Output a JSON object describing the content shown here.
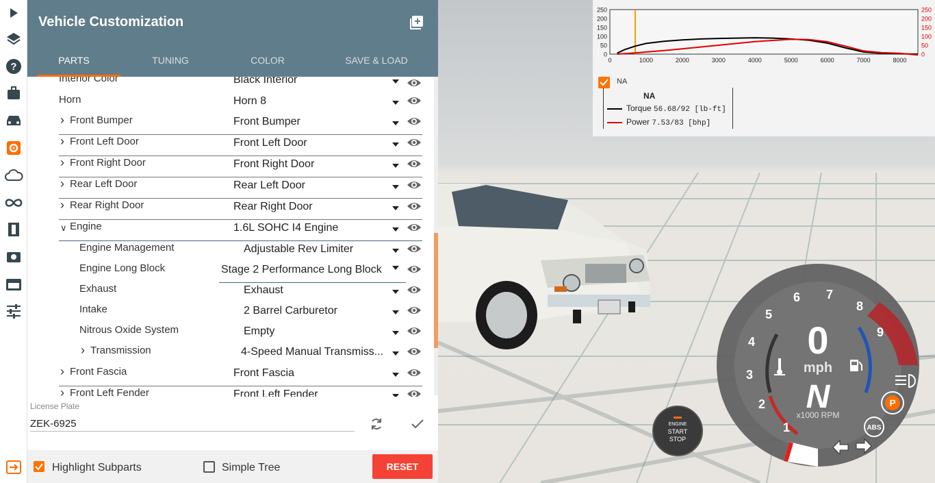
{
  "panel": {
    "title": "Vehicle Customization",
    "tabs": [
      "PARTS",
      "TUNING",
      "COLOR",
      "SAVE & LOAD"
    ],
    "active_tab": "PARTS"
  },
  "parts": [
    {
      "label": "Interior Color",
      "value": "Black Interior",
      "expandable": false
    },
    {
      "label": "Horn",
      "value": "Horn 8",
      "expandable": false
    },
    {
      "label": "Front Bumper",
      "value": "Front Bumper",
      "expandable": true
    },
    {
      "label": "Front Left Door",
      "value": "Front Left Door",
      "expandable": true
    },
    {
      "label": "Front Right Door",
      "value": "Front Right Door",
      "expandable": true
    },
    {
      "label": "Rear Left Door",
      "value": "Rear Left Door",
      "expandable": true
    },
    {
      "label": "Rear Right Door",
      "value": "Rear Right Door",
      "expandable": true
    },
    {
      "label": "Engine",
      "value": "1.6L SOHC I4 Engine",
      "expandable": true,
      "expanded": true
    },
    {
      "label": "Engine Management",
      "value": "Adjustable Rev Limiter",
      "expandable": false
    },
    {
      "label": "Engine Long Block",
      "value": "Stage 2 Performance Long Block",
      "expandable": false
    },
    {
      "label": "Exhaust",
      "value": "Exhaust",
      "expandable": false
    },
    {
      "label": "Intake",
      "value": "2 Barrel Carburetor",
      "expandable": false
    },
    {
      "label": "Nitrous Oxide System",
      "value": "Empty",
      "expandable": false
    },
    {
      "label": "Transmission",
      "value": "4-Speed Manual Transmiss...",
      "expandable": true
    },
    {
      "label": "Front Fascia",
      "value": "Front Fascia",
      "expandable": true
    },
    {
      "label": "Front Left Fender",
      "value": "Front Left Fender",
      "expandable": true
    }
  ],
  "license": {
    "label": "License Plate",
    "value": "ZEK-6925"
  },
  "footer": {
    "highlight_label": "Highlight Subparts",
    "highlight_checked": true,
    "simple_label": "Simple Tree",
    "simple_checked": false,
    "reset_label": "RESET"
  },
  "graph": {
    "left_ticks": [
      "250",
      "200",
      "150",
      "100",
      "50",
      "0"
    ],
    "right_ticks": [
      "250",
      "200",
      "150",
      "100",
      "50",
      "0"
    ],
    "x_ticks": [
      "0",
      "1000",
      "2000",
      "3000",
      "4000",
      "5000",
      "6000",
      "7000",
      "8000"
    ],
    "checkbox_label": "NA",
    "legend_title": "NA",
    "torque_label": "Torque",
    "torque_value": "56.68/92 [lb-ft]",
    "power_label": "Power",
    "power_value": "7.53/83  [bhp]",
    "torque_color": "#000000",
    "power_color": "#e00000"
  },
  "chart_data": {
    "type": "line",
    "title": "",
    "xlabel": "",
    "ylabel": "",
    "xlim": [
      0,
      8500
    ],
    "ylim": [
      0,
      250
    ],
    "current_rpm": 700,
    "series": [
      {
        "name": "Torque",
        "x": [
          200,
          400,
          700,
          1000,
          1500,
          2000,
          2500,
          3000,
          3500,
          4000,
          4500,
          5000,
          5500,
          6000,
          6500,
          7000,
          7500,
          8000,
          8500
        ],
        "y": [
          5,
          25,
          45,
          60,
          72,
          80,
          85,
          88,
          90,
          92,
          90,
          85,
          78,
          62,
          35,
          12,
          5,
          2,
          0
        ]
      },
      {
        "name": "Power",
        "x": [
          200,
          700,
          1000,
          1500,
          2000,
          2500,
          3000,
          3500,
          4000,
          4500,
          5000,
          5500,
          6000,
          6500,
          7000,
          7500,
          8000,
          8500
        ],
        "y": [
          0,
          7,
          12,
          20,
          30,
          40,
          50,
          60,
          70,
          77,
          83,
          82,
          70,
          45,
          18,
          8,
          5,
          -5
        ]
      }
    ]
  },
  "hud": {
    "speed": "0",
    "unit": "mph",
    "gear": "N",
    "rpm_label": "x1000 RPM",
    "rpm_ticks": [
      "1",
      "2",
      "3",
      "4",
      "5",
      "6",
      "7",
      "8",
      "9"
    ],
    "abs_label": "ABS",
    "park_label": "P",
    "engine_button": [
      "ENGINE",
      "START",
      "STOP"
    ],
    "accent_color": "#ff6d00",
    "redline_color": "#c0272d"
  },
  "iconbar": [
    "play-icon",
    "layers-icon",
    "help-icon",
    "briefcase-icon",
    "car-icon",
    "gear-icon",
    "cloud-icon",
    "infinity-icon",
    "film-icon",
    "camera-icon",
    "window-icon",
    "sliders-icon",
    "exit-icon"
  ]
}
